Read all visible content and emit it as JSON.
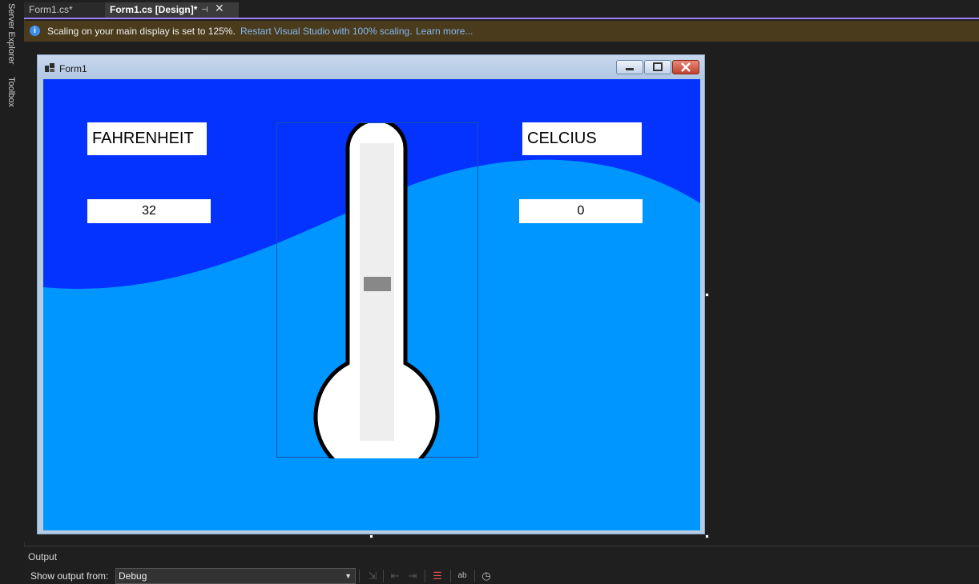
{
  "sidebar": {
    "server_explorer": "Server Explorer",
    "toolbox": "Toolbox"
  },
  "tabs": [
    {
      "label": "Form1.cs*"
    },
    {
      "label": "Form1.cs [Design]*"
    }
  ],
  "infobar": {
    "message": "Scaling on your main display is set to 125%.",
    "link_restart": "Restart Visual Studio with 100% scaling.",
    "link_learn": "Learn more..."
  },
  "form": {
    "title": "Form1",
    "fahrenheit_label": "FAHRENHEIT",
    "celsius_label": "CELCIUS",
    "fahrenheit_value": "32",
    "celsius_value": "0"
  },
  "output": {
    "title": "Output",
    "show_from_label": "Show output from:",
    "source": "Debug"
  },
  "colors": {
    "accent": "#9f80ff",
    "wave_dark": "#0433ff",
    "wave_light": "#0096ff",
    "thermometer_outline": "#000000",
    "thermometer_tube": "#eeeeee",
    "mercury": "#888888"
  }
}
